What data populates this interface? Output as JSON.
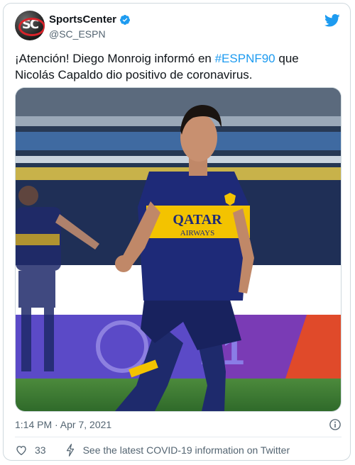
{
  "author": {
    "display_name": "SportsCenter",
    "handle": "@SC_ESPN",
    "verified": true
  },
  "tweet": {
    "text_before": "¡Atención! Diego Monroig informó en ",
    "hashtag": "#ESPNF90",
    "text_after": " que Nicolás Capaldo dio positivo de coronavirus."
  },
  "media": {
    "jersey_sponsor": "QATAR",
    "jersey_sponsor_sub": "AIRWAYS",
    "ad_board": "21"
  },
  "meta": {
    "timestamp": "1:14 PM · Apr 7, 2021"
  },
  "actions": {
    "like_count": "33",
    "covid_link": "See the latest COVID-19 information on Twitter"
  },
  "colors": {
    "accent": "#1d9bf0",
    "boca_blue": "#1c2a6e",
    "boca_gold": "#f3c300",
    "pitch_green": "#3f7a36"
  }
}
